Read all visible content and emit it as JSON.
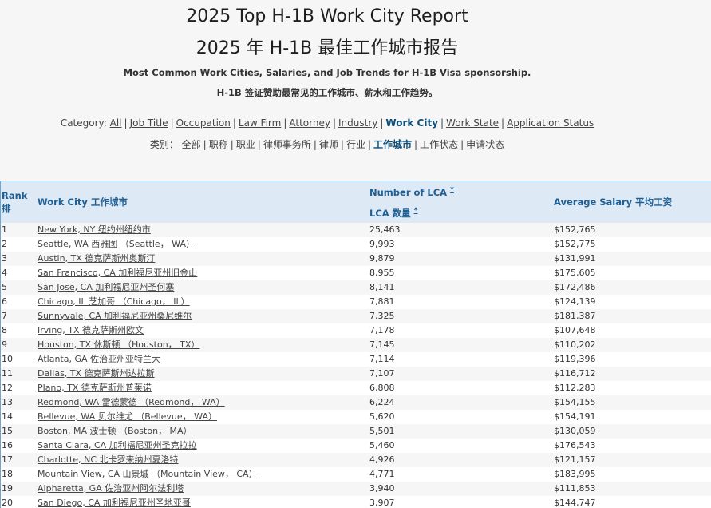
{
  "header": {
    "title_en": "2025 Top H-1B Work City Report",
    "title_zh": "2025 年 H-1B 最佳工作城市报告",
    "subtitle_en": "Most Common Work Cities, Salaries, and Job Trends for H-1B Visa sponsorship.",
    "subtitle_zh": "H-1B 签证赞助最常见的工作城市、薪水和工作趋势。"
  },
  "category_en": {
    "label": "Category:",
    "items": [
      "All",
      "Job Title",
      "Occupation",
      "Law Firm",
      "Attorney",
      "Industry",
      "Work City",
      "Work State",
      "Application Status"
    ],
    "active_index": 6
  },
  "category_zh": {
    "label": "类别：",
    "items": [
      "全部",
      "职称",
      "职业",
      "律师事务所",
      "律师",
      "行业",
      "工作城市",
      "工作状态",
      "申请状态"
    ],
    "active_index": 6
  },
  "table": {
    "headers": {
      "rank_en": "Rank",
      "rank_zh": "排",
      "city": "Work City  工作城市",
      "lca_en": "Number of LCA",
      "lca_zh": "LCA 数量",
      "sort_marker": "*",
      "salary": "Average Salary  平均工资"
    },
    "rows": [
      {
        "rank": "1",
        "city": "New York, NY  纽约州纽约市",
        "lca": "25,463",
        "salary": "$152,765"
      },
      {
        "rank": "2",
        "city": "Seattle, WA  西雅图 （Seattle， WA）",
        "lca": "9,993",
        "salary": "$152,775"
      },
      {
        "rank": "3",
        "city": "Austin, TX  德克萨斯州奥斯汀",
        "lca": "9,879",
        "salary": "$131,991"
      },
      {
        "rank": "4",
        "city": "San Francisco, CA  加利福尼亚州旧金山",
        "lca": "8,955",
        "salary": "$175,605"
      },
      {
        "rank": "5",
        "city": "San Jose, CA  加利福尼亚州圣何塞",
        "lca": "8,141",
        "salary": "$172,486"
      },
      {
        "rank": "6",
        "city": "Chicago, IL  芝加哥 （Chicago， IL）",
        "lca": "7,881",
        "salary": "$124,139"
      },
      {
        "rank": "7",
        "city": "Sunnyvale, CA  加利福尼亚州桑尼维尔",
        "lca": "7,325",
        "salary": "$181,387"
      },
      {
        "rank": "8",
        "city": "Irving, TX  德克萨斯州欧文",
        "lca": "7,178",
        "salary": "$107,648"
      },
      {
        "rank": "9",
        "city": "Houston, TX  休斯顿 （Houston， TX）",
        "lca": "7,145",
        "salary": "$110,202"
      },
      {
        "rank": "10",
        "city": "Atlanta, GA  佐治亚州亚特兰大",
        "lca": "7,114",
        "salary": "$119,396"
      },
      {
        "rank": "11",
        "city": "Dallas, TX  德克萨斯州达拉斯",
        "lca": "7,107",
        "salary": "$116,712"
      },
      {
        "rank": "12",
        "city": "Plano, TX  德克萨斯州普莱诺",
        "lca": "6,808",
        "salary": "$112,283"
      },
      {
        "rank": "13",
        "city": "Redmond, WA  雷德蒙德 （Redmond， WA）",
        "lca": "6,224",
        "salary": "$154,155"
      },
      {
        "rank": "14",
        "city": "Bellevue, WA  贝尔维尤 （Bellevue， WA）",
        "lca": "5,620",
        "salary": "$154,191"
      },
      {
        "rank": "15",
        "city": "Boston, MA  波士顿 （Boston， MA）",
        "lca": "5,501",
        "salary": "$130,059"
      },
      {
        "rank": "16",
        "city": "Santa Clara, CA  加利福尼亚州圣克拉拉",
        "lca": "5,460",
        "salary": "$176,543"
      },
      {
        "rank": "17",
        "city": "Charlotte, NC  北卡罗来纳州夏洛特",
        "lca": "4,926",
        "salary": "$121,157"
      },
      {
        "rank": "18",
        "city": "Mountain View, CA  山景城 （Mountain View， CA）",
        "lca": "4,771",
        "salary": "$183,995"
      },
      {
        "rank": "19",
        "city": "Alpharetta, GA  佐治亚州阿尔法利塔",
        "lca": "3,940",
        "salary": "$111,853"
      },
      {
        "rank": "20",
        "city": "San Diego, CA  加利福尼亚州圣地亚哥",
        "lca": "3,907",
        "salary": "$144,747"
      }
    ]
  }
}
